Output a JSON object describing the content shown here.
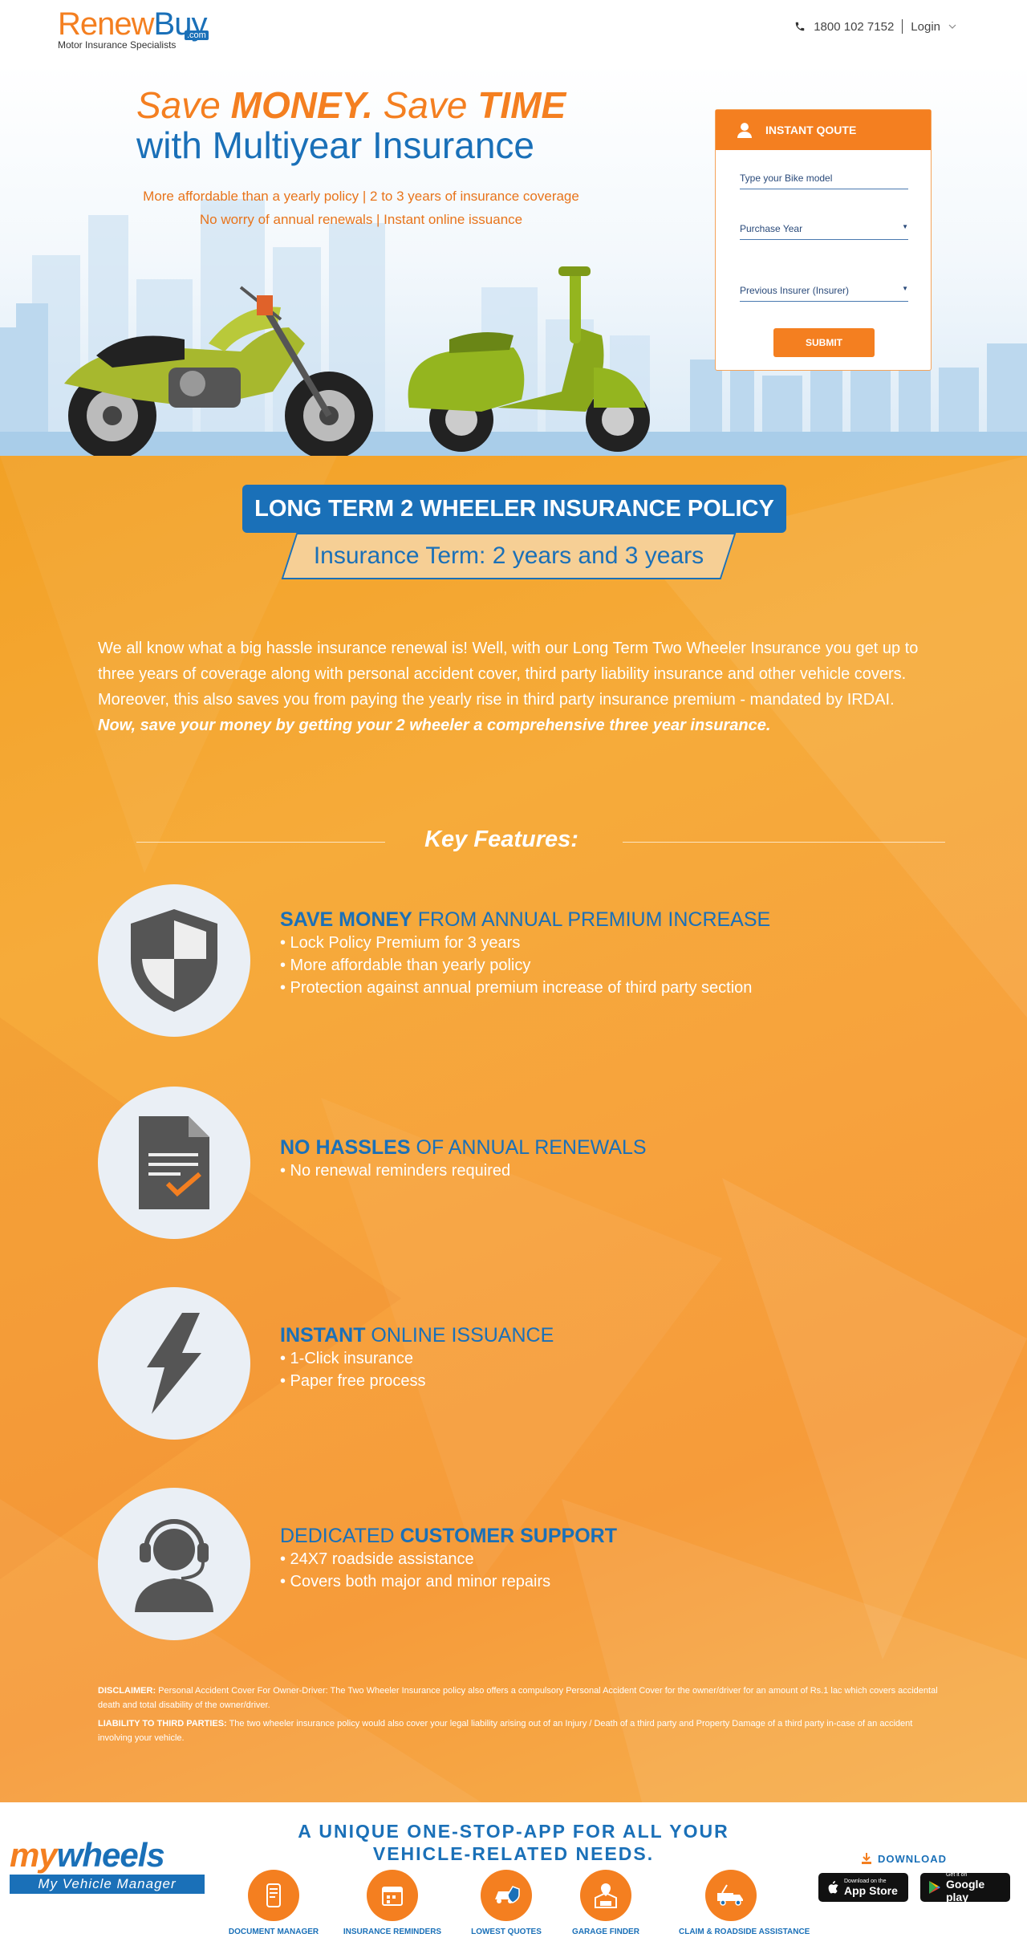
{
  "header": {
    "logo_renew": "Renew",
    "logo_buy": "Buy",
    "logo_com": ".com",
    "logo_subtitle": "Motor Insurance Specialists",
    "phone": "1800 102 7152",
    "login": "Login"
  },
  "hero": {
    "title_save1": "Save ",
    "title_money": "MONEY.",
    "title_save2": " Save ",
    "title_time": "TIME",
    "title_line2": "with Multiyear Insurance",
    "sub_line1": "More affordable than a yearly policy | 2 to 3 years of insurance coverage",
    "sub_line2": "No worry of annual renewals | Instant online issuance"
  },
  "quote": {
    "header": "INSTANT QOUTE",
    "bike_placeholder": "Type your Bike model",
    "purchase_year": "Purchase Year",
    "previous_insurer": "Previous Insurer (Insurer)",
    "submit": "SUBMIT"
  },
  "policy": {
    "banner": "LONG TERM 2 WHEELER INSURANCE POLICY",
    "term": "Insurance Term: 2 years and 3 years",
    "intro": "We all know what a big hassle insurance renewal is! Well, with our Long Term Two Wheeler Insurance you get up to three years of coverage along with personal accident cover, third party liability insurance and other vehicle covers. Moreover, this also saves you from paying the yearly rise in third party insurance premium - mandated by IRDAI. ",
    "intro_bold": "Now, save your money by getting your 2 wheeler a comprehensive three year insurance."
  },
  "key_features": {
    "title": "Key Features:",
    "items": [
      {
        "bold": "SAVE MONEY",
        "rest": " FROM ANNUAL PREMIUM INCREASE",
        "icon": "shield-icon",
        "points": [
          "• Lock Policy Premium for 3 years",
          "• More affordable than yearly policy",
          "• Protection against annual premium increase of third party section"
        ]
      },
      {
        "bold": "NO HASSLES",
        "rest": " OF ANNUAL RENEWALS",
        "icon": "document-check-icon",
        "points": [
          "• No renewal reminders required"
        ]
      },
      {
        "bold": "INSTANT",
        "rest": " ONLINE ISSUANCE",
        "icon": "lightning-icon",
        "points": [
          "• 1-Click insurance",
          "• Paper free process"
        ]
      },
      {
        "pre": "DEDICATED ",
        "bold": "CUSTOMER SUPPORT",
        "icon": "headset-agent-icon",
        "points": [
          "• 24X7 roadside assistance",
          "• Covers both major and minor repairs"
        ]
      }
    ]
  },
  "disclaimer": {
    "label1": "DISCLAIMER:",
    "text1": " Personal Accident Cover For Owner-Driver: The Two Wheeler Insurance policy also offers a compulsory Personal Accident Cover for the owner/driver for an amount of Rs.1 lac which covers accidental death and total disability of the owner/driver.",
    "label2": "LIABILITY TO THIRD PARTIES:",
    "text2": " The two wheeler insurance policy would also cover your legal liability arising out of an Injury / Death of a third party and Property Damage of a third party in-case of an accident involving your vehicle."
  },
  "footer": {
    "logo_my": "my",
    "logo_wheels": "wheels",
    "tagline": "My Vehicle Manager",
    "title_line1": "A UNIQUE ONE-STOP-APP FOR ALL YOUR",
    "title_line2": "VEHICLE-RELATED NEEDS.",
    "features": [
      {
        "label": "DOCUMENT MANAGER",
        "icon": "document-phone-icon"
      },
      {
        "label": "INSURANCE REMINDERS",
        "icon": "calendar-icon"
      },
      {
        "label": "LOWEST QUOTES",
        "icon": "car-shield-icon"
      },
      {
        "label": "GARAGE FINDER",
        "icon": "garage-pin-icon"
      },
      {
        "label": "CLAIM & ROADSIDE ASSISTANCE",
        "icon": "tow-truck-icon"
      }
    ],
    "download": "DOWNLOAD",
    "appstore_small": "Download on the",
    "appstore_big": "App Store",
    "play_small": "Get it on",
    "play_big": "Google play"
  },
  "colors": {
    "brand_orange": "#f47f20",
    "brand_blue": "#1a70b8",
    "section_orange": "#f6a43c"
  }
}
